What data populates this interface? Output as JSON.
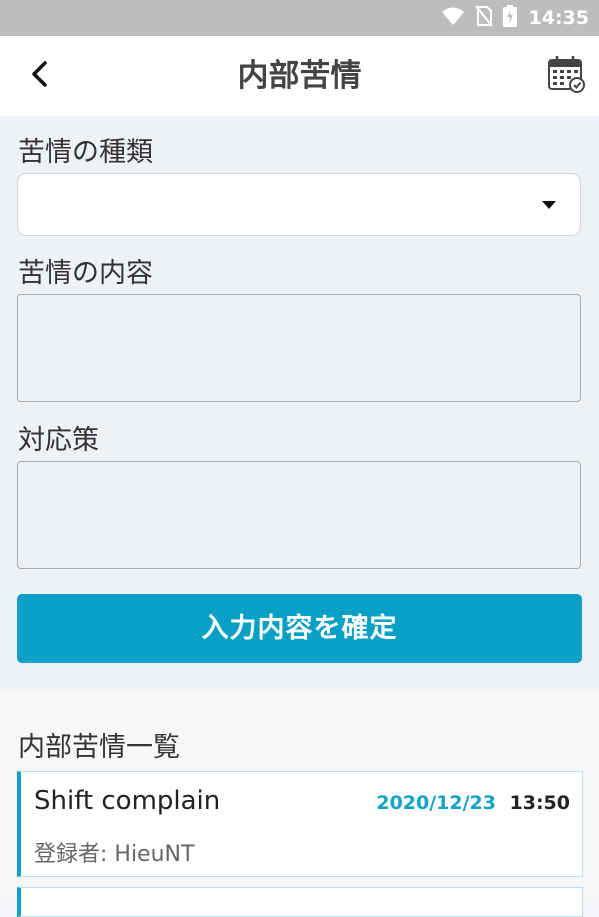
{
  "status_bar": {
    "time": "14:35",
    "icons": [
      "wifi-icon",
      "no-sim-icon",
      "battery-charging-icon"
    ]
  },
  "app_bar": {
    "back_icon": "back-arrow-icon",
    "title": "内部苦情",
    "calendar_icon": "calendar-icon"
  },
  "form": {
    "type_label": "苦情の種類",
    "type_value": "",
    "content_label": "苦情の内容",
    "content_value": "",
    "response_label": "対応策",
    "response_value": "",
    "submit_label": "入力内容を確定"
  },
  "list": {
    "title": "内部苦情一覧",
    "items": [
      {
        "title": "Shift complain",
        "date": "2020/12/23",
        "time": "13:50",
        "registrant": "登録者: HieuNT"
      }
    ]
  },
  "colors": {
    "accent": "#0aa0c6",
    "date": "#15a3c9",
    "status_bar": "#bdbdbd",
    "form_bg": "#eef2f6"
  }
}
